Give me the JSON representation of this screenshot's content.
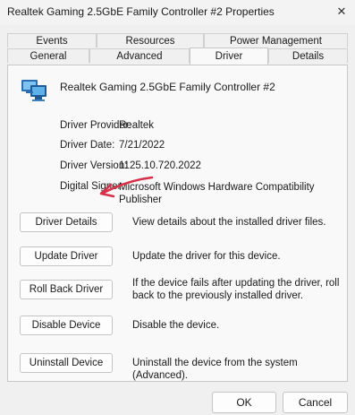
{
  "window": {
    "title": "Realtek Gaming 2.5GbE Family Controller #2 Properties",
    "close_glyph": "✕"
  },
  "tabs_row1": [
    {
      "label": "Events"
    },
    {
      "label": "Resources"
    },
    {
      "label": "Power Management"
    }
  ],
  "tabs_row2": [
    {
      "label": "General"
    },
    {
      "label": "Advanced"
    },
    {
      "label": "Driver",
      "active": true
    },
    {
      "label": "Details"
    }
  ],
  "device": {
    "name": "Realtek Gaming 2.5GbE Family Controller #2",
    "icon": "network-adapter-icon"
  },
  "info": {
    "provider_label": "Driver Provider:",
    "provider": "Realtek",
    "date_label": "Driver Date:",
    "date": "7/21/2022",
    "version_label": "Driver Version:",
    "version": "1125.10.720.2022",
    "signer_label": "Digital Signer:",
    "signer": "Microsoft Windows Hardware Compatibility Publisher"
  },
  "actions": [
    {
      "label": "Driver Details",
      "desc": "View details about the installed driver files."
    },
    {
      "label": "Update Driver",
      "desc": "Update the driver for this device."
    },
    {
      "label": "Roll Back Driver",
      "desc": "If the device fails after updating the driver, roll back to the previously installed driver."
    },
    {
      "label": "Disable Device",
      "desc": "Disable the device."
    },
    {
      "label": "Uninstall Device",
      "desc": "Uninstall the device from the system (Advanced)."
    }
  ],
  "annotation": {
    "arrow_color": "#d9304a"
  },
  "footer": {
    "ok": "OK",
    "cancel": "Cancel"
  }
}
